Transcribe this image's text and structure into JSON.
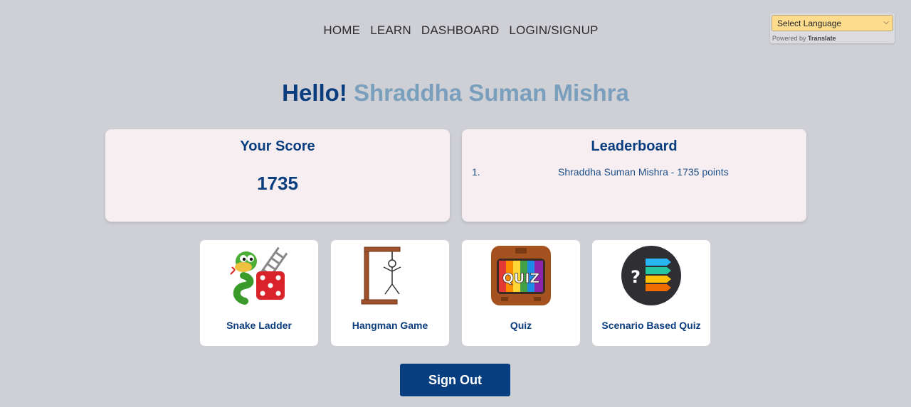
{
  "nav": {
    "items": [
      "HOME",
      "LEARN",
      "DASHBOARD",
      "LOGIN/SIGNUP"
    ]
  },
  "translate": {
    "select_value": "Select Language",
    "powered_prefix": "Powered by",
    "powered_brand": "Translate"
  },
  "greeting": {
    "hello": "Hello!",
    "name": "Shraddha Suman Mishra"
  },
  "score_card": {
    "title": "Your Score",
    "value": "1735"
  },
  "leaderboard": {
    "title": "Leaderboard",
    "entries": [
      {
        "rank": "1.",
        "text": "Shraddha Suman Mishra - 1735 points"
      }
    ]
  },
  "games": [
    {
      "label": "Snake Ladder",
      "icon": "snake-ladder-icon"
    },
    {
      "label": "Hangman Game",
      "icon": "hangman-icon"
    },
    {
      "label": "Quiz",
      "icon": "quiz-tv-icon"
    },
    {
      "label": "Scenario Based Quiz",
      "icon": "scenario-quiz-icon"
    }
  ],
  "signout": {
    "label": "Sign Out"
  },
  "colors": {
    "background": "#cfcfd6",
    "primary": "#0b3e7f",
    "name_accent": "#7a9fbc",
    "card_bg": "#f6eef0"
  }
}
